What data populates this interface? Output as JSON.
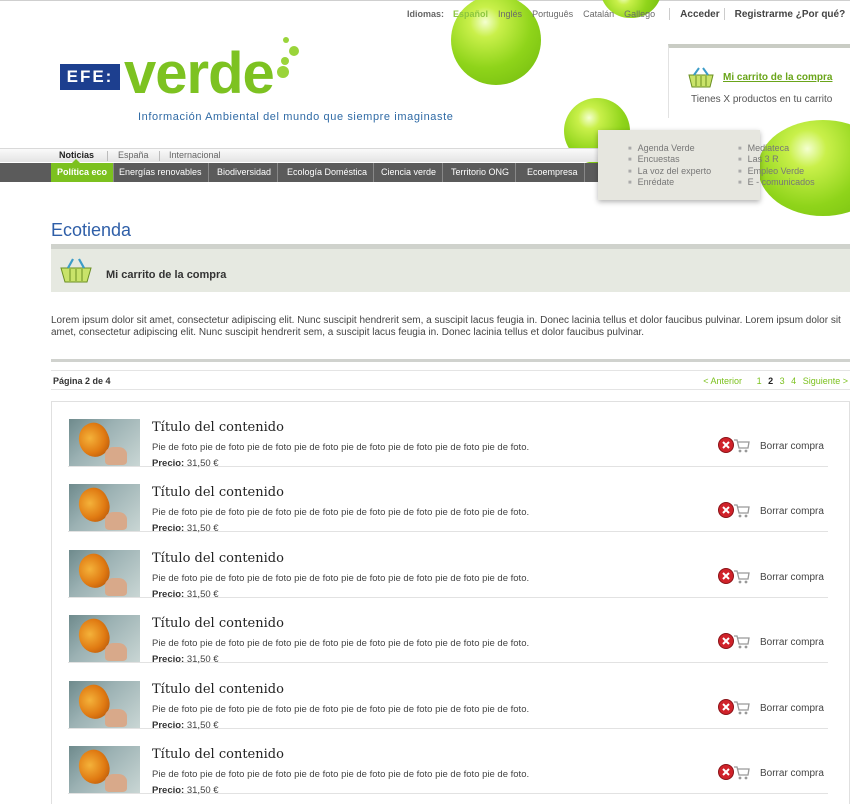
{
  "topbar": {
    "languages_label": "Idiomas:",
    "languages": [
      "Español",
      "Inglés",
      "Português",
      "Catalán",
      "Gallego"
    ],
    "login": "Acceder",
    "register": "Registrarme ¿Por qué?"
  },
  "logo": {
    "efe": "EFE:",
    "brand": "verde",
    "tagline": "Información Ambiental del mundo que siempre imaginaste"
  },
  "cart_widget": {
    "title": "Mi carrito de la compra",
    "text": "Tienes X productos en tu carrito",
    "icon": "shopping-basket-icon"
  },
  "nav": {
    "primary": [
      "Noticias",
      "España",
      "Internacional"
    ],
    "secondary": [
      "Política eco",
      "Energías renovables",
      "Biodiversidad",
      "Ecología Doméstica",
      "Ciencia verde",
      "Territorio ONG",
      "Ecoempresa"
    ]
  },
  "dropdown": {
    "col1": [
      "Agenda Verde",
      "Encuestas",
      "La voz del experto",
      "Enrédate"
    ],
    "col2": [
      "Mediateca",
      "Las 3 R",
      "Empleo Verde",
      "E - comunicados"
    ]
  },
  "main": {
    "heading": "Ecotienda",
    "cart_strip_title": "Mi carrito de la compra",
    "intro": "Lorem ipsum dolor sit amet, consectetur adipiscing elit. Nunc suscipit hendrerit sem, a suscipit lacus feugia in. Donec lacinia tellus et dolor faucibus pulvinar. Lorem ipsum dolor sit amet, consectetur adipiscing elit. Nunc suscipit hendrerit sem, a suscipit lacus feugia in. Donec lacinia tellus et dolor faucibus pulvinar."
  },
  "pager": {
    "label": "Página 2 de 4",
    "prev": "<  Anterior",
    "pages": [
      "1",
      "2",
      "3",
      "4"
    ],
    "current": "2",
    "next": "Siguiente >"
  },
  "items": [
    {
      "title": "Título del contenido",
      "desc": "Pie de foto pie de foto pie de foto pie de foto pie de foto pie de foto pie de foto pie de foto.",
      "price_label": "Precio:",
      "price": "31,50 €",
      "delete": "Borrar compra"
    },
    {
      "title": "Título del contenido",
      "desc": "Pie de foto pie de foto pie de foto pie de foto pie de foto pie de foto pie de foto pie de foto.",
      "price_label": "Precio:",
      "price": "31,50 €",
      "delete": "Borrar compra"
    },
    {
      "title": "Título del contenido",
      "desc": "Pie de foto pie de foto pie de foto pie de foto pie de foto pie de foto pie de foto pie de foto.",
      "price_label": "Precio:",
      "price": "31,50 €",
      "delete": "Borrar compra"
    },
    {
      "title": "Título del contenido",
      "desc": "Pie de foto pie de foto pie de foto pie de foto pie de foto pie de foto pie de foto pie de foto.",
      "price_label": "Precio:",
      "price": "31,50 €",
      "delete": "Borrar compra"
    },
    {
      "title": "Título del contenido",
      "desc": "Pie de foto pie de foto pie de foto pie de foto pie de foto pie de foto pie de foto pie de foto.",
      "price_label": "Precio:",
      "price": "31,50 €",
      "delete": "Borrar compra"
    },
    {
      "title": "Título del contenido",
      "desc": "Pie de foto pie de foto pie de foto pie de foto pie de foto pie de foto pie de foto pie de foto.",
      "price_label": "Precio:",
      "price": "31,50 €",
      "delete": "Borrar compra"
    }
  ],
  "colors": {
    "accent_green": "#7cc11f",
    "brand_blue": "#2f5fa8",
    "nav_dark": "#5b5b5b"
  }
}
